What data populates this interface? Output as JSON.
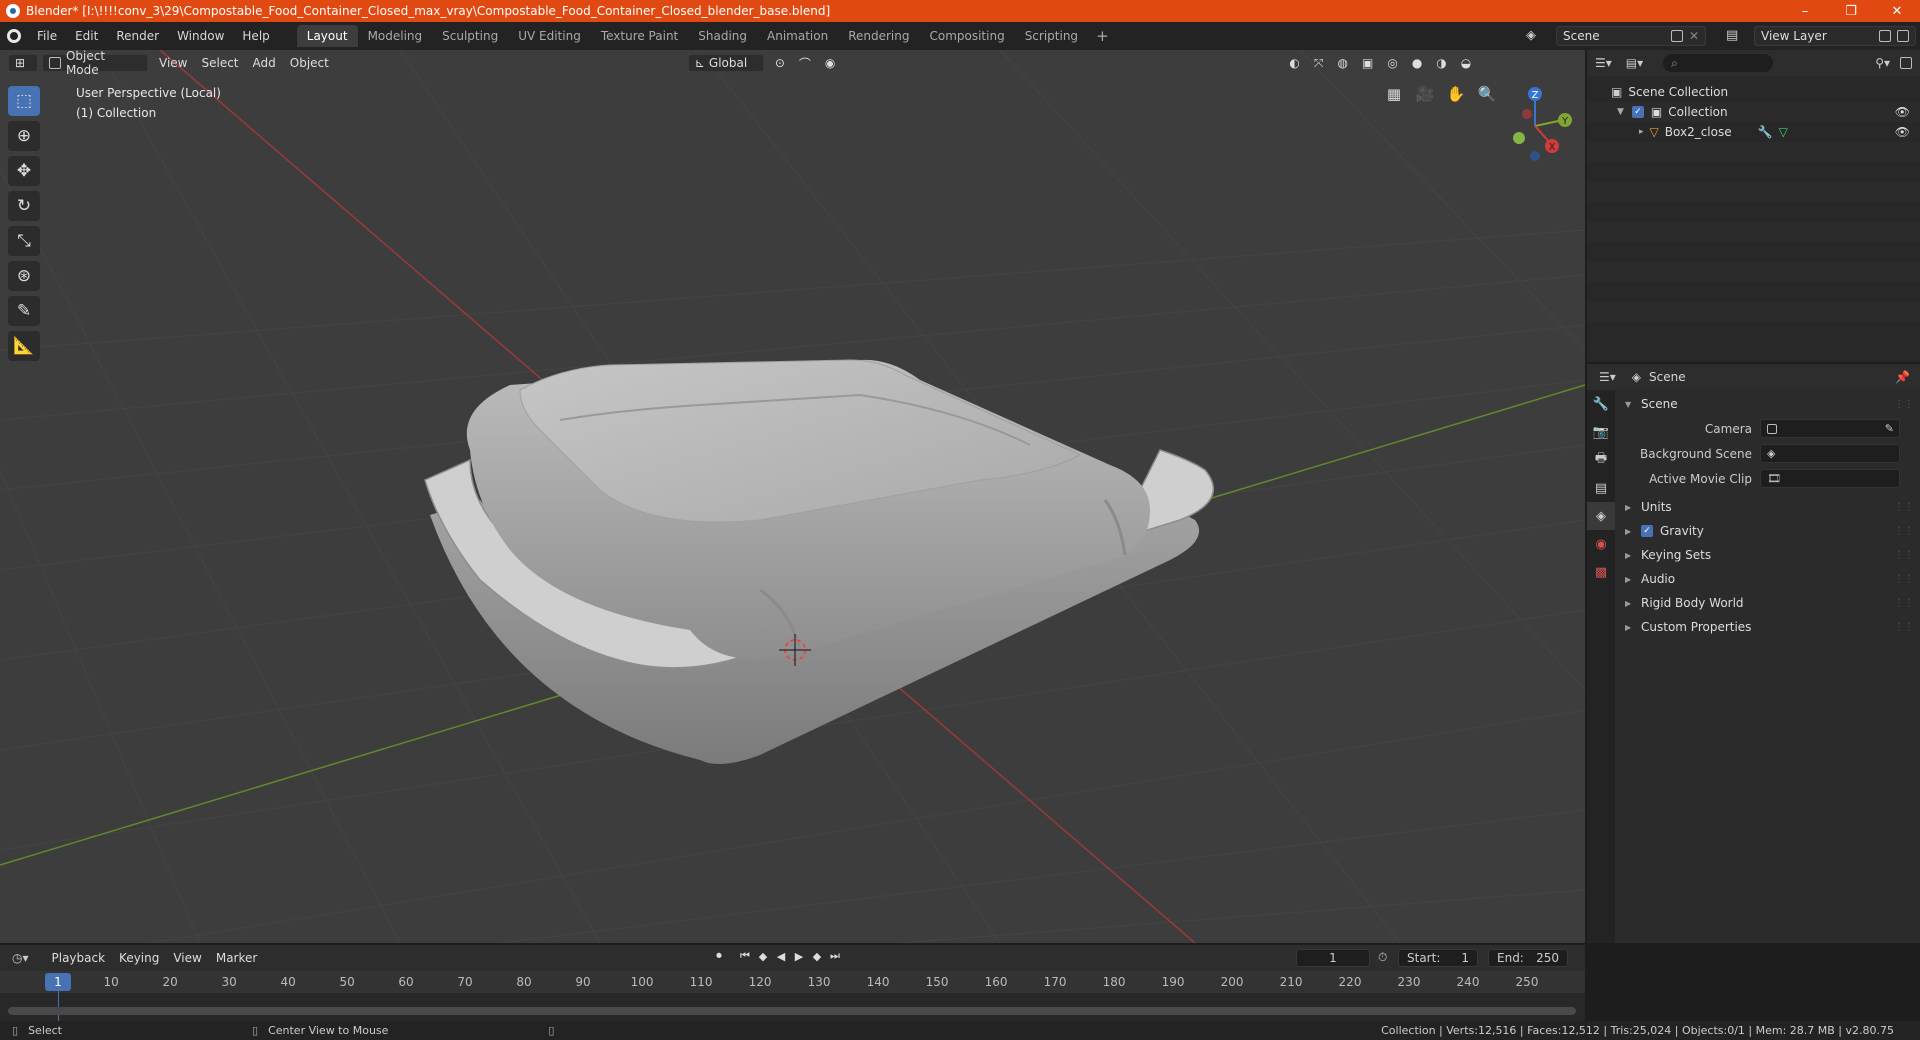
{
  "titlebar": {
    "title": "Blender* [I:\\!!!!conv_3\\29\\Compostable_Food_Container_Closed_max_vray\\Compostable_Food_Container_Closed_blender_base.blend]",
    "minimize": "–",
    "restore": "❐",
    "close": "✕"
  },
  "menu": [
    "File",
    "Edit",
    "Render",
    "Window",
    "Help"
  ],
  "workspaces": [
    "Layout",
    "Modeling",
    "Sculpting",
    "UV Editing",
    "Texture Paint",
    "Shading",
    "Animation",
    "Rendering",
    "Compositing",
    "Scripting"
  ],
  "active_workspace": "Layout",
  "scene_name": "Scene",
  "view_layer": "View Layer",
  "viewport": {
    "mode": "Object Mode",
    "menus": [
      "View",
      "Select",
      "Add",
      "Object"
    ],
    "orientation": "Global",
    "perspective_label": "User Perspective (Local)",
    "collection_label": "(1) Collection",
    "gizmo": {
      "x": "X",
      "y": "Y",
      "z": "Z"
    }
  },
  "outliner": {
    "search_placeholder": "",
    "items": [
      {
        "label": "Scene Collection"
      },
      {
        "label": "Collection"
      },
      {
        "label": "Box2_close"
      }
    ]
  },
  "properties": {
    "header": "Scene",
    "section": "Scene",
    "fields": [
      {
        "label": "Camera",
        "value": ""
      },
      {
        "label": "Background Scene",
        "value": ""
      },
      {
        "label": "Active Movie Clip",
        "value": ""
      }
    ],
    "panels": [
      "Units",
      "Gravity",
      "Keying Sets",
      "Audio",
      "Rigid Body World",
      "Custom Properties"
    ]
  },
  "timeline": {
    "menus": [
      "Playback",
      "Keying",
      "View",
      "Marker"
    ],
    "current_frame": "1",
    "start_label": "Start:",
    "start": "1",
    "end_label": "End:",
    "end": "250",
    "ticks": [
      "1",
      "10",
      "20",
      "30",
      "40",
      "50",
      "60",
      "70",
      "80",
      "90",
      "100",
      "110",
      "120",
      "130",
      "140",
      "150",
      "160",
      "170",
      "180",
      "190",
      "200",
      "210",
      "220",
      "230",
      "240",
      "250"
    ]
  },
  "statusbar": {
    "left": "Select",
    "middle": "Center View to Mouse",
    "right": "Collection | Verts:12,516 | Faces:12,512 | Tris:25,024 | Objects:0/1 | Mem: 28.7 MB | v2.80.75"
  }
}
